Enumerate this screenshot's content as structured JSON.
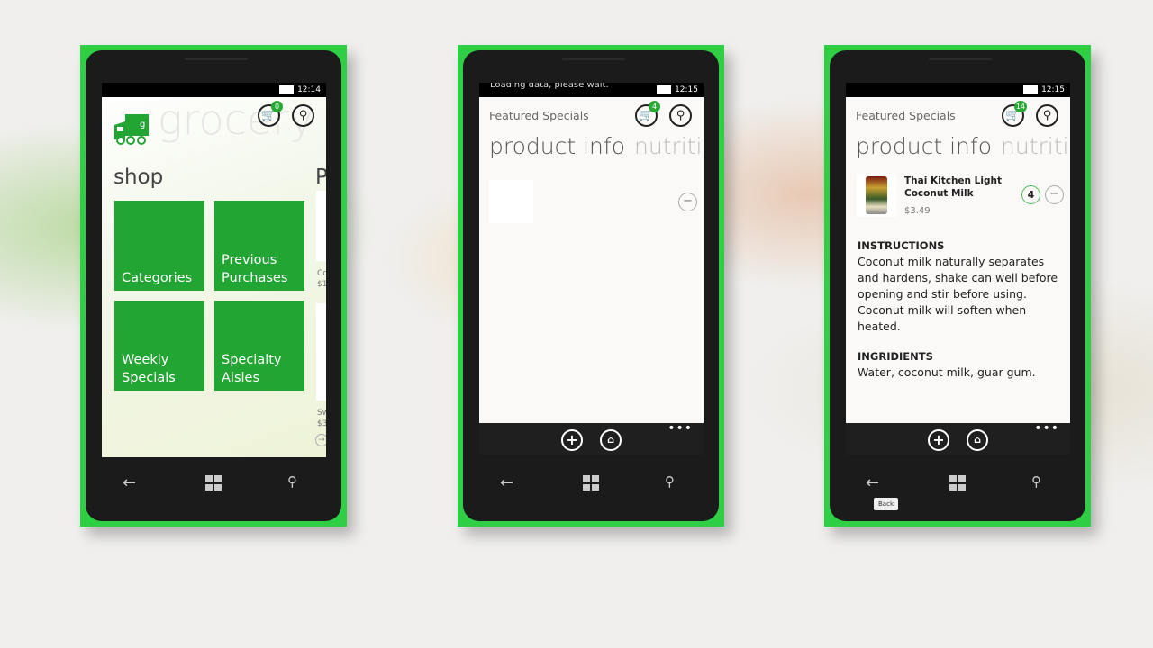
{
  "phones": [
    {
      "time": "12:14",
      "cart_count": "0",
      "logo_text": "grocery",
      "section": "shop",
      "next_section": "P",
      "tiles": [
        "Categories",
        "Previous Purchases",
        "Weekly Specials",
        "Specialty Aisles"
      ],
      "peek_items": [
        {
          "name": "Co",
          "price": "$1"
        },
        {
          "name": "Sw",
          "price": "$3"
        }
      ]
    },
    {
      "time": "12:15",
      "status_message": "Loading data, please wait.",
      "cart_count": "4",
      "header": "Featured Specials",
      "pivot_current": "product info",
      "pivot_next": "nutrition"
    },
    {
      "time": "12:15",
      "cart_count": "14",
      "header": "Featured Specials",
      "pivot_current": "product info",
      "pivot_next": "nutrition",
      "product": {
        "name": "Thai Kitchen Light Coconut Milk",
        "price": "$3.49",
        "quantity": "4"
      },
      "instructions_heading": "INSTRUCTIONS",
      "instructions": "Coconut milk naturally separates and hardens, shake can well before opening and stir before using. Coconut milk will soften when heated.",
      "ingredients_heading": "INGRIDIENTS",
      "ingredients": "Water, coconut milk, guar gum.",
      "tooltip": "Back"
    }
  ],
  "colors": {
    "accent": "#23a534",
    "frame": "#2fcf45"
  }
}
